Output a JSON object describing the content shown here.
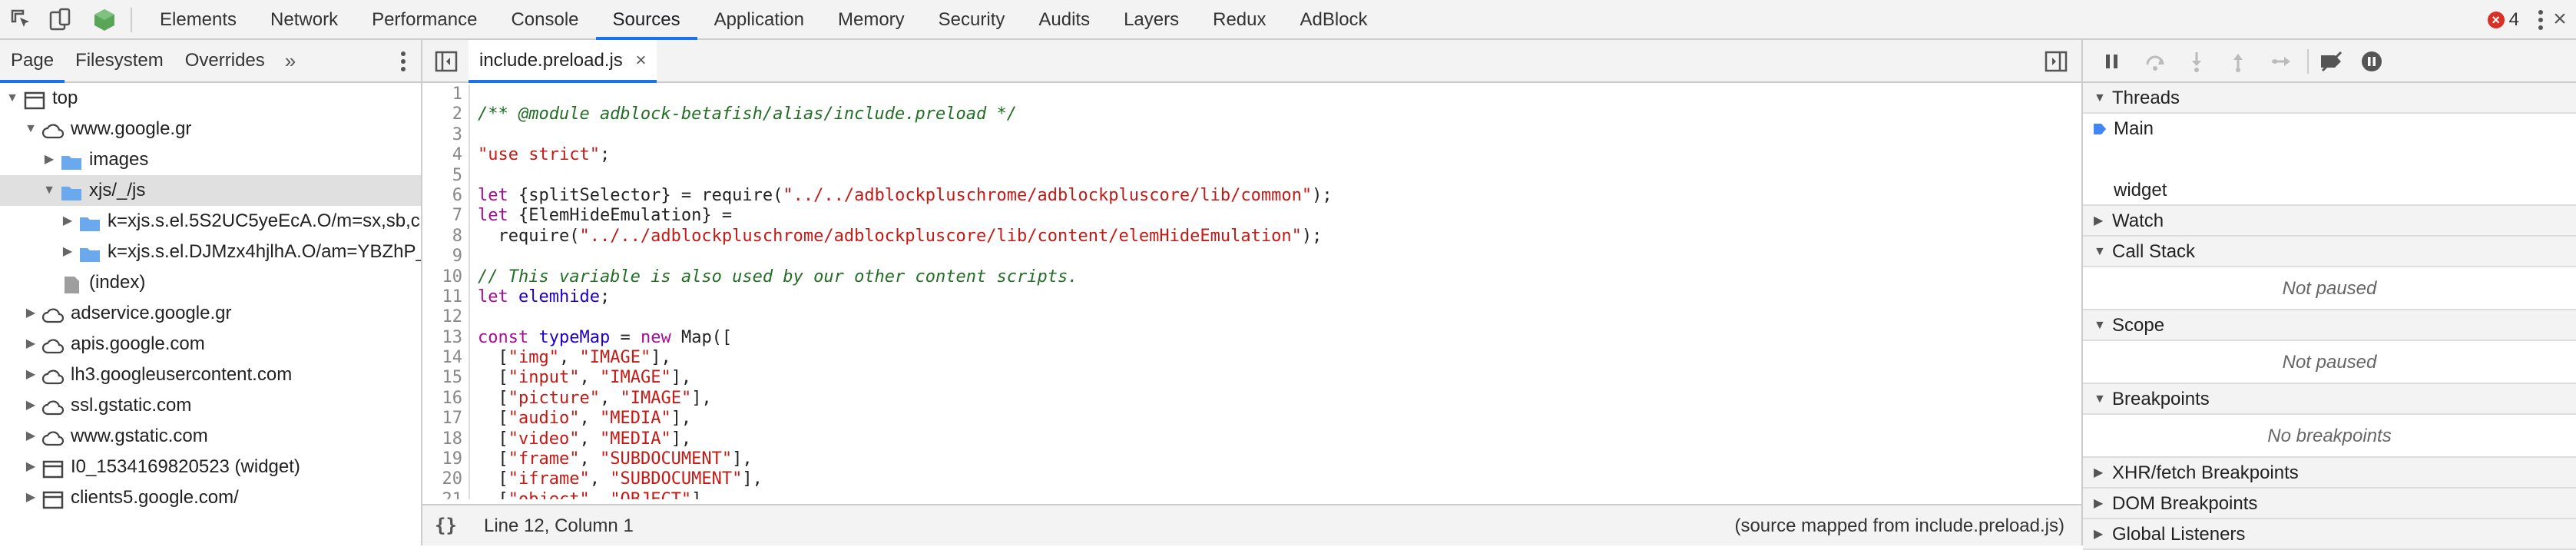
{
  "toolbar": {
    "tabs": [
      "Elements",
      "Network",
      "Performance",
      "Console",
      "Sources",
      "Application",
      "Memory",
      "Security",
      "Audits",
      "Layers",
      "Redux",
      "AdBlock"
    ],
    "active_tab": "Sources",
    "error_count": "4"
  },
  "navigator": {
    "tabs": [
      "Page",
      "Filesystem",
      "Overrides"
    ],
    "more": "»",
    "items": [
      {
        "label": "top",
        "icon": "frame-icon",
        "arrow": "open",
        "depth": 0
      },
      {
        "label": "www.google.gr",
        "icon": "cloud-icon",
        "arrow": "open",
        "depth": 1
      },
      {
        "label": "images",
        "icon": "folder-icon",
        "arrow": "closed",
        "depth": 2
      },
      {
        "label": "xjs/_/js",
        "icon": "folder-icon",
        "arrow": "open",
        "depth": 2,
        "selected": true
      },
      {
        "label": "k=xjs.s.el.5S2UC5yeEcA.O/m=sx,sb,c",
        "icon": "folder-icon",
        "arrow": "closed",
        "depth": 3
      },
      {
        "label": "k=xjs.s.el.DJMzx4hjlhA.O/am=YBZhP_",
        "icon": "folder-icon",
        "arrow": "closed",
        "depth": 3
      },
      {
        "label": "(index)",
        "icon": "file-icon",
        "arrow": "none",
        "depth": 2
      },
      {
        "label": "adservice.google.gr",
        "icon": "cloud-icon",
        "arrow": "closed",
        "depth": 1
      },
      {
        "label": "apis.google.com",
        "icon": "cloud-icon",
        "arrow": "closed",
        "depth": 1
      },
      {
        "label": "lh3.googleusercontent.com",
        "icon": "cloud-icon",
        "arrow": "closed",
        "depth": 1
      },
      {
        "label": "ssl.gstatic.com",
        "icon": "cloud-icon",
        "arrow": "closed",
        "depth": 1
      },
      {
        "label": "www.gstatic.com",
        "icon": "cloud-icon",
        "arrow": "closed",
        "depth": 1
      },
      {
        "label": "I0_1534169820523 (widget)",
        "icon": "frame-icon",
        "arrow": "closed",
        "depth": 1
      },
      {
        "label": "clients5.google.com/",
        "icon": "frame-icon",
        "arrow": "closed",
        "depth": 1
      }
    ]
  },
  "editor": {
    "file_tab": "include.preload.js",
    "close": "×",
    "lines": [
      [
        {
          "t": "",
          "c": "df"
        }
      ],
      [
        {
          "t": "/** @module adblock-betafish/alias/include.preload */",
          "c": "cm"
        }
      ],
      [
        {
          "t": "",
          "c": "df"
        }
      ],
      [
        {
          "t": "\"use strict\"",
          "c": "st"
        },
        {
          "t": ";",
          "c": "df"
        }
      ],
      [
        {
          "t": "",
          "c": "df"
        }
      ],
      [
        {
          "t": "let",
          "c": "kw"
        },
        {
          "t": " {splitSelector} = require(",
          "c": "df"
        },
        {
          "t": "\"../../adblockpluschrome/adblockpluscore/lib/common\"",
          "c": "st"
        },
        {
          "t": ");",
          "c": "df"
        }
      ],
      [
        {
          "t": "let",
          "c": "kw"
        },
        {
          "t": " {ElemHideEmulation} =",
          "c": "df"
        }
      ],
      [
        {
          "t": "  require(",
          "c": "df"
        },
        {
          "t": "\"../../adblockpluschrome/adblockpluscore/lib/content/elemHideEmulation\"",
          "c": "st"
        },
        {
          "t": ");",
          "c": "df"
        }
      ],
      [
        {
          "t": "",
          "c": "df"
        }
      ],
      [
        {
          "t": "// This variable is also used by our other content scripts.",
          "c": "cm"
        }
      ],
      [
        {
          "t": "let",
          "c": "kw"
        },
        {
          "t": " ",
          "c": "df"
        },
        {
          "t": "elemhide",
          "c": "vr"
        },
        {
          "t": ";",
          "c": "df"
        }
      ],
      [
        {
          "t": "",
          "c": "df"
        }
      ],
      [
        {
          "t": "const",
          "c": "kw"
        },
        {
          "t": " ",
          "c": "df"
        },
        {
          "t": "typeMap",
          "c": "vr"
        },
        {
          "t": " = ",
          "c": "df"
        },
        {
          "t": "new",
          "c": "kw"
        },
        {
          "t": " Map([",
          "c": "df"
        }
      ],
      [
        {
          "t": "  [",
          "c": "df"
        },
        {
          "t": "\"img\"",
          "c": "st"
        },
        {
          "t": ", ",
          "c": "df"
        },
        {
          "t": "\"IMAGE\"",
          "c": "st"
        },
        {
          "t": "],",
          "c": "df"
        }
      ],
      [
        {
          "t": "  [",
          "c": "df"
        },
        {
          "t": "\"input\"",
          "c": "st"
        },
        {
          "t": ", ",
          "c": "df"
        },
        {
          "t": "\"IMAGE\"",
          "c": "st"
        },
        {
          "t": "],",
          "c": "df"
        }
      ],
      [
        {
          "t": "  [",
          "c": "df"
        },
        {
          "t": "\"picture\"",
          "c": "st"
        },
        {
          "t": ", ",
          "c": "df"
        },
        {
          "t": "\"IMAGE\"",
          "c": "st"
        },
        {
          "t": "],",
          "c": "df"
        }
      ],
      [
        {
          "t": "  [",
          "c": "df"
        },
        {
          "t": "\"audio\"",
          "c": "st"
        },
        {
          "t": ", ",
          "c": "df"
        },
        {
          "t": "\"MEDIA\"",
          "c": "st"
        },
        {
          "t": "],",
          "c": "df"
        }
      ],
      [
        {
          "t": "  [",
          "c": "df"
        },
        {
          "t": "\"video\"",
          "c": "st"
        },
        {
          "t": ", ",
          "c": "df"
        },
        {
          "t": "\"MEDIA\"",
          "c": "st"
        },
        {
          "t": "],",
          "c": "df"
        }
      ],
      [
        {
          "t": "  [",
          "c": "df"
        },
        {
          "t": "\"frame\"",
          "c": "st"
        },
        {
          "t": ", ",
          "c": "df"
        },
        {
          "t": "\"SUBDOCUMENT\"",
          "c": "st"
        },
        {
          "t": "],",
          "c": "df"
        }
      ],
      [
        {
          "t": "  [",
          "c": "df"
        },
        {
          "t": "\"iframe\"",
          "c": "st"
        },
        {
          "t": ", ",
          "c": "df"
        },
        {
          "t": "\"SUBDOCUMENT\"",
          "c": "st"
        },
        {
          "t": "],",
          "c": "df"
        }
      ],
      [
        {
          "t": "  [",
          "c": "df"
        },
        {
          "t": "\"object\"",
          "c": "st"
        },
        {
          "t": ", ",
          "c": "df"
        },
        {
          "t": "\"OBJECT\"",
          "c": "st"
        },
        {
          "t": "],",
          "c": "df"
        }
      ]
    ],
    "status_braces": "{}",
    "cursor_position": "Line 12, Column 1",
    "source_mapped": "(source mapped from include.preload.js)"
  },
  "debugger": {
    "threads_title": "Threads",
    "threads": [
      "Main",
      "widget"
    ],
    "watch_title": "Watch",
    "callstack_title": "Call Stack",
    "callstack_status": "Not paused",
    "scope_title": "Scope",
    "scope_status": "Not paused",
    "breakpoints_title": "Breakpoints",
    "breakpoints_status": "No breakpoints",
    "xhr_title": "XHR/fetch Breakpoints",
    "dom_title": "DOM Breakpoints",
    "global_title": "Global Listeners"
  },
  "colors": {
    "accent": "#1a73e8",
    "error": "#d93025",
    "folder": "#6aa9ee",
    "comment": "#236e25",
    "keyword": "#aa0d91",
    "string": "#c41a16"
  }
}
